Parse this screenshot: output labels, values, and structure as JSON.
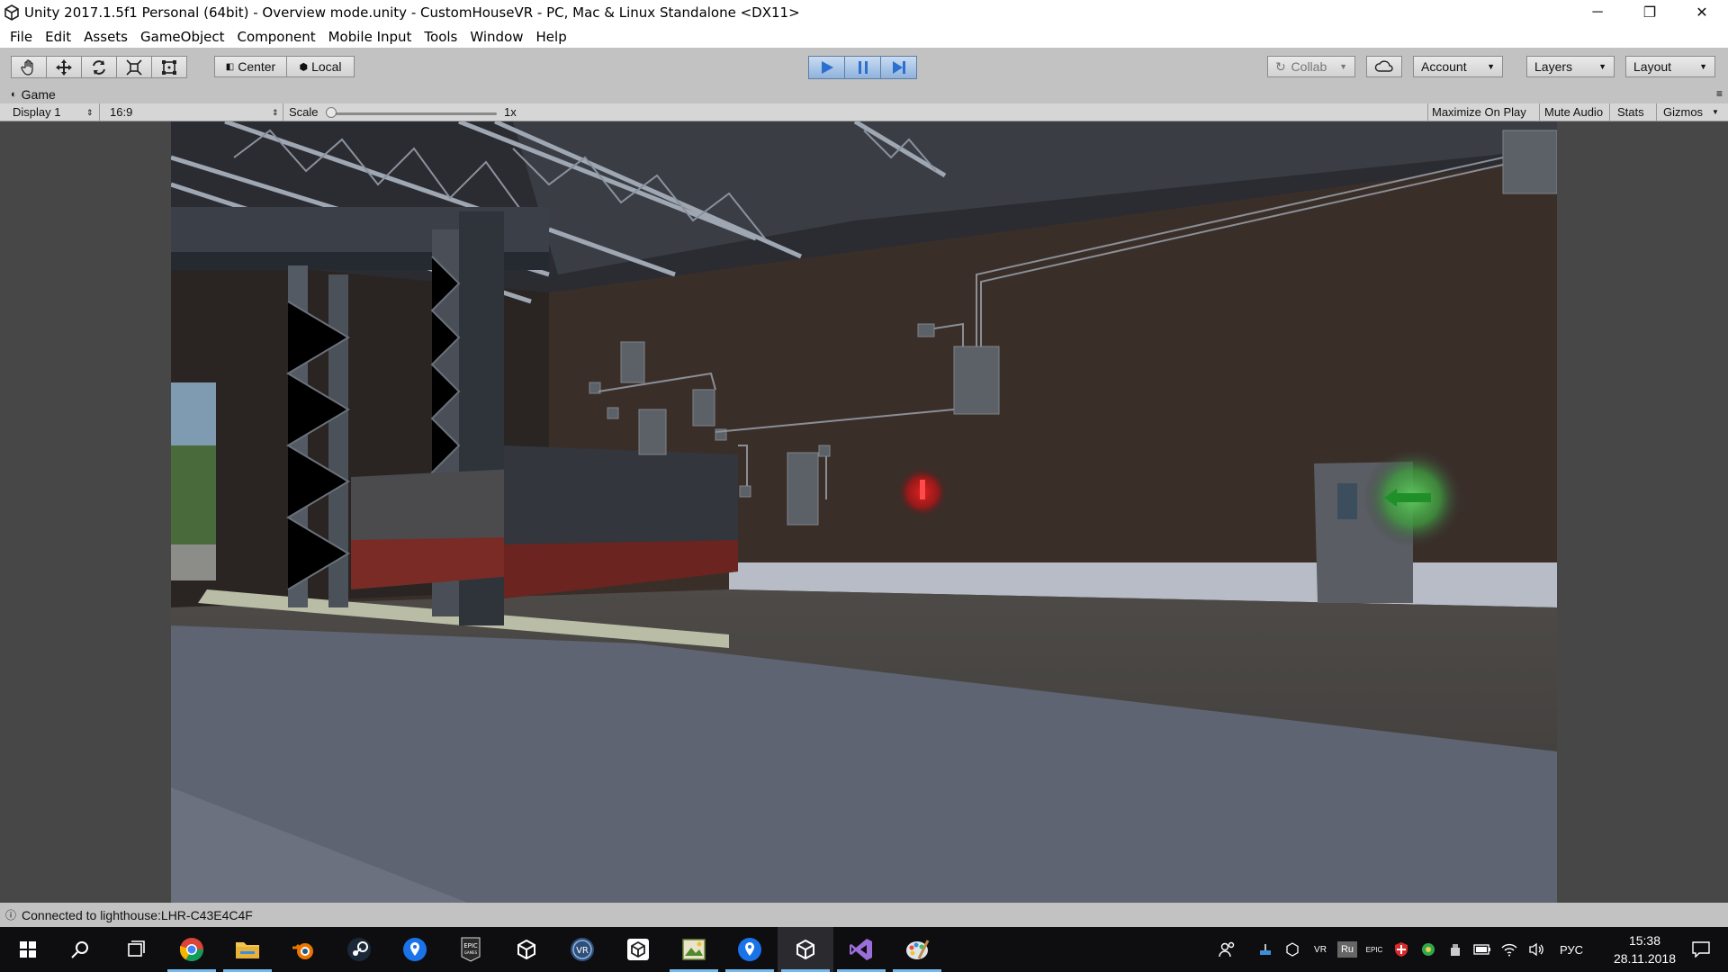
{
  "window": {
    "title": "Unity 2017.1.5f1 Personal (64bit) - Overview mode.unity - CustomHouseVR - PC, Mac & Linux Standalone <DX11>",
    "minimize": "─",
    "restore": "❐",
    "close": "✕"
  },
  "menu": [
    "File",
    "Edit",
    "Assets",
    "GameObject",
    "Component",
    "Mobile Input",
    "Tools",
    "Window",
    "Help"
  ],
  "toolbar": {
    "tools": [
      "hand-tool",
      "move-tool",
      "rotate-tool",
      "scale-tool",
      "rect-tool"
    ],
    "pivot_label": "Center",
    "space_label": "Local",
    "collab_label": "Collab",
    "account_label": "Account",
    "layers_label": "Layers",
    "layout_label": "Layout",
    "play_active": true
  },
  "game_tab": {
    "title": "Game",
    "display": "Display 1",
    "aspect": "16:9",
    "scale_label": "Scale",
    "scale_value": "1x",
    "maximize": "Maximize On Play",
    "mute": "Mute Audio",
    "stats": "Stats",
    "gizmos": "Gizmos"
  },
  "status": {
    "message": "Connected to lighthouse:LHR-C43E4C4F"
  },
  "taskbar": {
    "apps": [
      "start-icon",
      "search-icon",
      "task-view-icon",
      "chrome-icon",
      "file-explorer-icon",
      "blender-icon",
      "steam-icon",
      "maps-icon",
      "epic-games-icon",
      "unity-hub-icon",
      "vr-icon",
      "unity-icon",
      "image-app-icon",
      "maps-icon-2",
      "unity-editor-icon",
      "visual-studio-icon",
      "paint-icon"
    ],
    "lang": "РУС",
    "time": "15:38",
    "date": "28.11.2018",
    "tray_vr": "VR",
    "tray_ru": "Ru"
  },
  "colors": {
    "accent_play": "#3a7fd5",
    "marker_red": "#d01818",
    "marker_green": "#2fa82f"
  }
}
